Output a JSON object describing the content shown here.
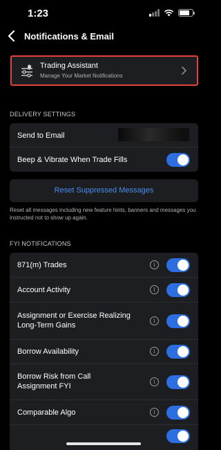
{
  "status_bar": {
    "time": "1:23"
  },
  "header": {
    "title": "Notifications & Email"
  },
  "trading_assistant": {
    "title": "Trading Assistant",
    "subtitle": "Manage Your Market Notifications"
  },
  "delivery": {
    "section_label": "DELIVERY SETTINGS",
    "rows": [
      {
        "label": "Send to Email"
      },
      {
        "label": "Beep & Vibrate When Trade Fills",
        "toggle": true
      }
    ],
    "reset_label": "Reset Suppressed Messages",
    "reset_note": "Reset all messages including new feature hints, banners and messages you instructed not to show up again."
  },
  "fyi": {
    "section_label": "FYI NOTIFICATIONS",
    "rows": [
      {
        "label": "871(m) Trades",
        "toggle": true
      },
      {
        "label": "Account Activity",
        "toggle": true
      },
      {
        "label": "Assignment or Exercise Realizing Long-Term Gains",
        "toggle": true
      },
      {
        "label": "Borrow Availability",
        "toggle": true
      },
      {
        "label": "Borrow Risk from Call Assignment FYI",
        "toggle": true
      },
      {
        "label": "Comparable Algo",
        "toggle": true
      }
    ]
  },
  "colors": {
    "accent": "#2d6ee0",
    "link": "#4a8ff0",
    "highlight_border": "#e8413c",
    "card": "#1c1e21"
  }
}
